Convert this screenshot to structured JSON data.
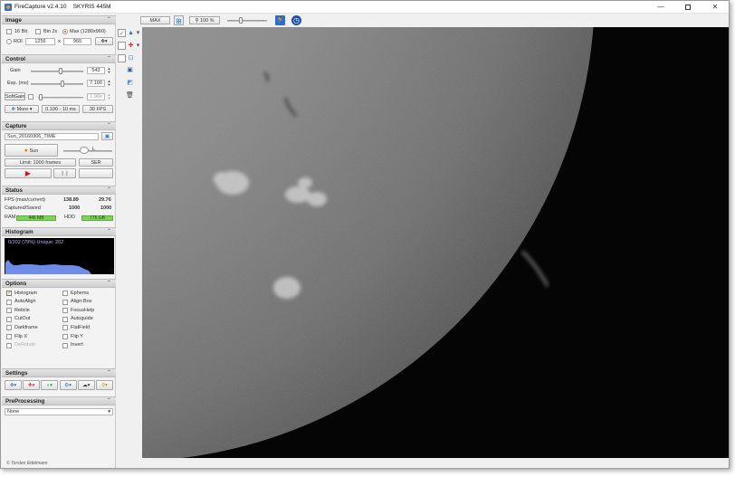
{
  "window": {
    "title": "FireCapture v2.4.10",
    "camera": "SKYRIS 445M",
    "min_glyph": "—",
    "close_glyph": "✕"
  },
  "sections": {
    "image": "Image",
    "control": "Control",
    "capture": "Capture",
    "status": "Status",
    "histogram": "Histogram",
    "options": "Options",
    "settings": "Settings",
    "preprocessing": "PreProcessing"
  },
  "collapse_glyph": "⌃",
  "image": {
    "bit16": "16 Bit",
    "bin2x": "Bin 2x",
    "max": "Max (1280x960)",
    "roi": "ROI",
    "roi_w": "1256",
    "roi_x": "x",
    "roi_h": "960",
    "gear_glyph": "✥▾"
  },
  "control": {
    "gain_label": "Gain",
    "gain_value": "543",
    "gain_level": 0.57,
    "exp_label": "Exp. (ms)",
    "exp_value": "7.100",
    "exp_level": 0.6,
    "softgain_label": "SoftGain",
    "softgain_value": "1.00x",
    "softgain_level": 0.05,
    "more_label": "More",
    "range": "0.100 - 10 ms",
    "fps": "30 FPS"
  },
  "capture": {
    "filename": "Sun_20160306_TIME",
    "folder_glyph": "▣",
    "profile": "Sun",
    "filter": "L",
    "limit": "Limit: 1000 frames",
    "format": "SER",
    "play_glyph": "▶",
    "pause_glyph": "❚❚"
  },
  "status": {
    "fps_label": "FPS (max/current)",
    "fps_max": "138.89",
    "fps_current": "29.76",
    "captured_label": "Captured/Saved",
    "captured": "1000",
    "saved": "1000",
    "ram_label": "RAM",
    "ram_value": "446 MB",
    "hdd_label": "HDD",
    "hdd_value": "776 GB"
  },
  "histogram": {
    "text": "0/202 (79%)   Unique: 202"
  },
  "options": {
    "items": [
      {
        "label": "Histogram",
        "checked": true,
        "enabled": true
      },
      {
        "label": "Ephems",
        "checked": false,
        "enabled": true
      },
      {
        "label": "AutoAlign",
        "checked": false,
        "enabled": true
      },
      {
        "label": "Align-Box",
        "checked": false,
        "enabled": true
      },
      {
        "label": "Reticle",
        "checked": false,
        "enabled": true
      },
      {
        "label": "FocusHelp",
        "checked": false,
        "enabled": true
      },
      {
        "label": "CutOut",
        "checked": false,
        "enabled": true
      },
      {
        "label": "Autoguide",
        "checked": false,
        "enabled": true
      },
      {
        "label": "Darkframe",
        "checked": false,
        "enabled": true
      },
      {
        "label": "FlatField",
        "checked": false,
        "enabled": true
      },
      {
        "label": "Flip X",
        "checked": false,
        "enabled": true
      },
      {
        "label": "Flip Y",
        "checked": false,
        "enabled": true
      },
      {
        "label": "DeRotate",
        "checked": false,
        "enabled": false
      },
      {
        "label": "Invert",
        "checked": false,
        "enabled": true
      }
    ]
  },
  "settings": {
    "icons": [
      "✥▾",
      "✚▾",
      "◐▾",
      "⚙▾",
      "☁▾",
      "⚲▾"
    ]
  },
  "preprocessing": {
    "value": "None",
    "arrow": "▾"
  },
  "toolbar": {
    "max_label": "MAX",
    "zoom_label": "100 %",
    "zoom_glyph": "⚲",
    "zoom_level": 0.35,
    "run_glyph": "🏃",
    "timer_glyph": "◷",
    "fit_glyph": "⊞"
  },
  "sidetools": {
    "icons": [
      "✓",
      "▲",
      "▾",
      "□",
      "✚",
      "▾",
      "□",
      "⊡",
      "▣",
      "◩",
      "🗑"
    ]
  },
  "copyright": "© Torsten Edelmann",
  "colors": {
    "accent": "#d06800",
    "ram_bar": "#7fd35a",
    "histogram_fill": "#6f8ce8"
  }
}
